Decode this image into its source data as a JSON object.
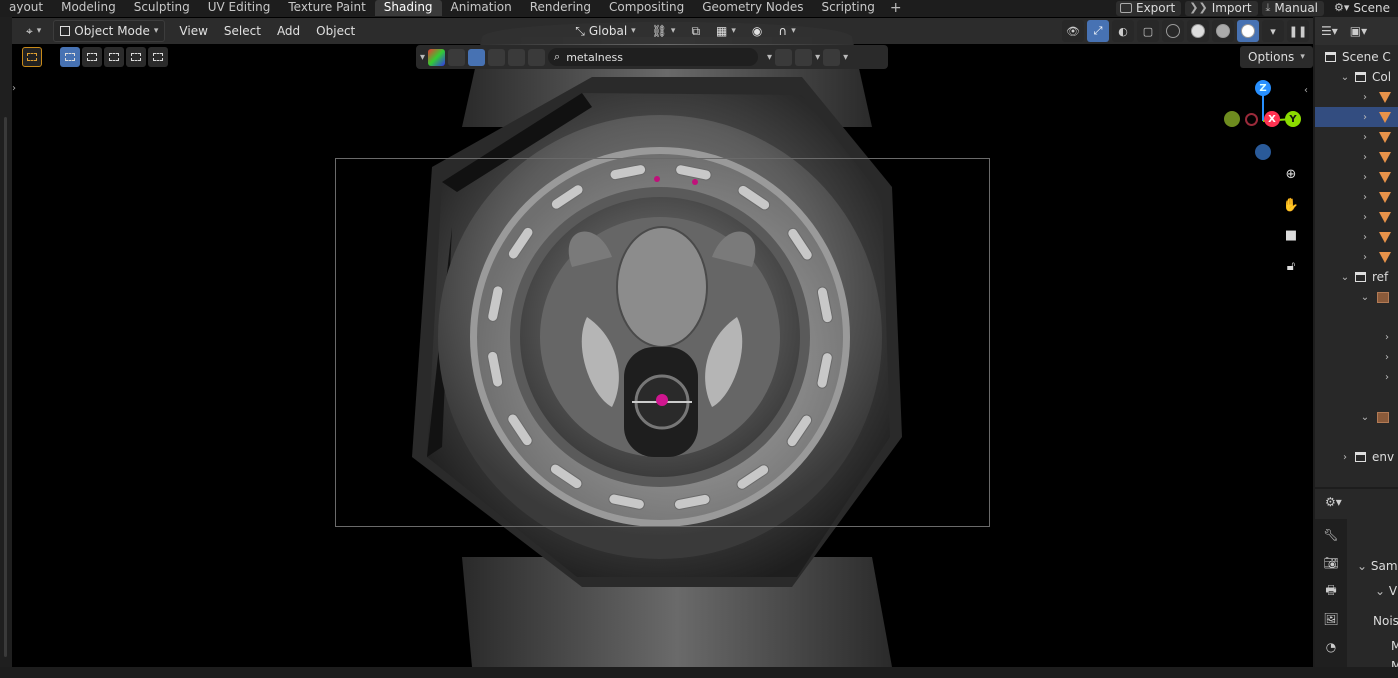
{
  "workspaces": {
    "tabs": [
      "Layout",
      "Modeling",
      "Sculpting",
      "UV Editing",
      "Texture Paint",
      "Shading",
      "Animation",
      "Rendering",
      "Compositing",
      "Geometry Nodes",
      "Scripting"
    ],
    "visible_tabs": [
      "ayout",
      "Modeling",
      "Sculpting",
      "UV Editing",
      "Texture Paint",
      "Shading",
      "Animation",
      "Rendering",
      "Compositing",
      "Geometry Nodes",
      "Scripting"
    ],
    "active": "Shading",
    "add_label": "+"
  },
  "topright": {
    "export_label": "Export",
    "import_label": "Import",
    "manual_label": "Manual",
    "scene_label": "Scene"
  },
  "viewport_header": {
    "mode_label": "Object Mode",
    "menu_view": "View",
    "menu_select": "Select",
    "menu_add": "Add",
    "menu_object": "Object",
    "orientation_label": "Global"
  },
  "nav_filter": {
    "search_value": "metalness"
  },
  "options_label": "Options",
  "gizmo": {
    "z": "Z",
    "x": "X",
    "y": "Y"
  },
  "outliner": {
    "scene_label": "Scene C",
    "collection_label": "Col",
    "ref_label": "ref",
    "env_label": "env",
    "mesh_rows": 9,
    "selected_row": 1
  },
  "properties": {
    "panel_sampling": "Sam",
    "panel_viewport": "Vi",
    "noise_label": "Nois",
    "row_m1": "M",
    "row_m2": "M"
  },
  "colors": {
    "accent_blue": "#4772b3",
    "axis_x": "#ff3352",
    "axis_y": "#8bdc00",
    "axis_z": "#2890ff",
    "mesh_orange": "#e8934a"
  }
}
